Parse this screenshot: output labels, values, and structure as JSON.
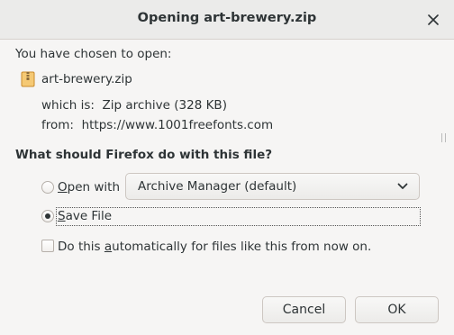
{
  "window": {
    "title": "Opening art-brewery.zip",
    "close_icon": "close-icon"
  },
  "intro": {
    "text": "You have chosen to open:"
  },
  "file": {
    "icon": "zip-archive-icon",
    "name": "art-brewery.zip",
    "which_is_label": "which is:",
    "which_is_value": "Zip archive (328 KB)",
    "from_label": "from:",
    "from_value": "https://www.1001freefonts.com"
  },
  "question": {
    "text": "What should Firefox do with this file?"
  },
  "options": {
    "open_with": {
      "label_prefix": "",
      "mnemonic": "O",
      "label_rest": "pen with",
      "selected": false,
      "app": "Archive Manager (default)"
    },
    "save_file": {
      "mnemonic": "S",
      "label_rest": "ave File",
      "selected": true
    }
  },
  "auto": {
    "label_before": "Do this ",
    "mnemonic": "a",
    "label_after": "utomatically for files like this from now on.",
    "checked": false
  },
  "buttons": {
    "cancel": "Cancel",
    "ok": "OK"
  }
}
